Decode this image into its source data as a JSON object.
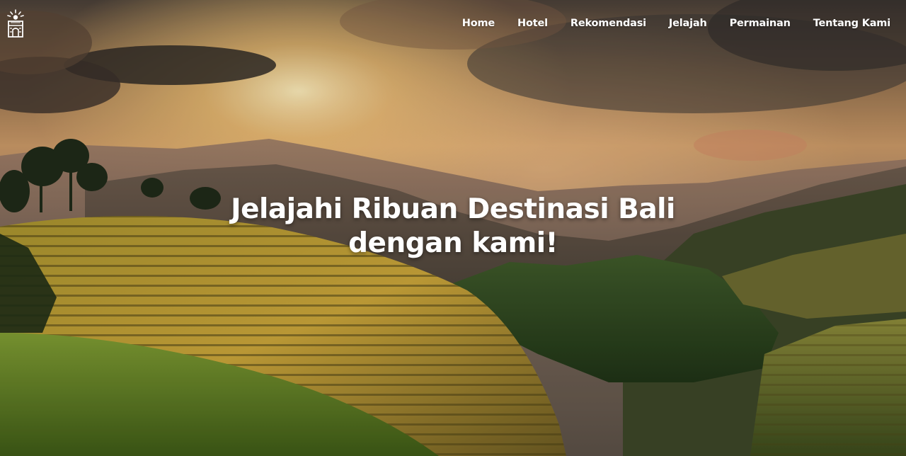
{
  "brand": {
    "logo_icon": "temple-gate-icon"
  },
  "nav": {
    "items": [
      {
        "label": "Home"
      },
      {
        "label": "Hotel"
      },
      {
        "label": "Rekomendasi"
      },
      {
        "label": "Jelajah"
      },
      {
        "label": "Permainan"
      },
      {
        "label": "Tentang Kami"
      }
    ]
  },
  "hero": {
    "headline_line1": "Jelajahi Ribuan Destinasi Bali",
    "headline_line2": "dengan kami!",
    "background_description_icon": "rice-terrace-sunset-photo"
  },
  "colors": {
    "text": "#ffffff",
    "sky_glow": "#f3c77a",
    "terrace_gold": "#c9a43a",
    "terrace_green": "#5f7a2a",
    "shadow": "#2a2420"
  }
}
